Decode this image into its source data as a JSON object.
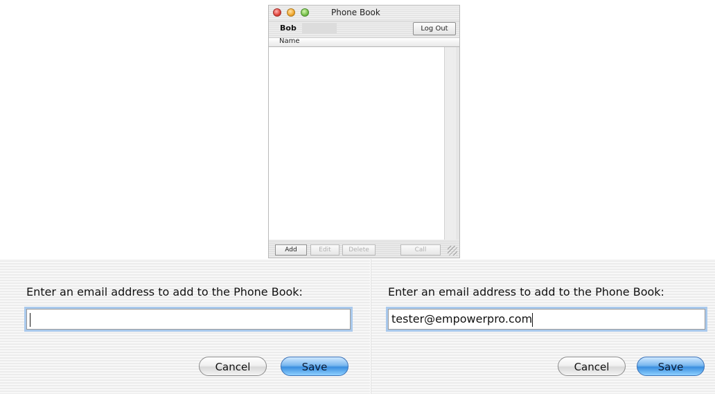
{
  "window": {
    "title": "Phone Book",
    "user": "Bob",
    "logout_label": "Log Out",
    "column_header": "Name",
    "buttons": {
      "add": "Add",
      "edit": "Edit",
      "delete": "Delete",
      "call": "Call"
    }
  },
  "dialog_left": {
    "prompt": "Enter an email address to add to the Phone Book:",
    "input_value": "",
    "cancel_label": "Cancel",
    "save_label": "Save"
  },
  "dialog_right": {
    "prompt": "Enter an email address to add to the Phone Book:",
    "input_value": "tester@empowerpro.com",
    "cancel_label": "Cancel",
    "save_label": "Save"
  },
  "colors": {
    "focus_ring": "#a9c9ec",
    "save_button": "#3b8fe0",
    "close_light": "#e0443a",
    "minimize_light": "#f0a830",
    "zoom_light": "#78c04a"
  }
}
